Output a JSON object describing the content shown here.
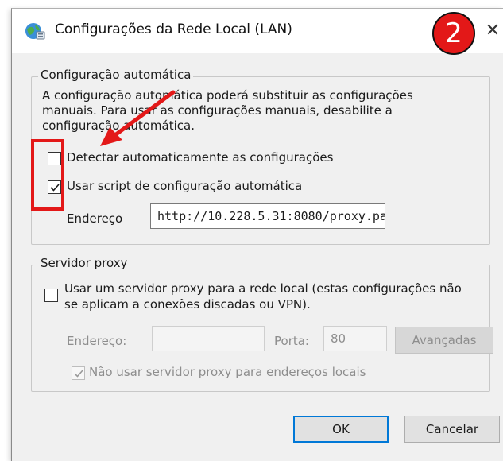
{
  "window": {
    "title": "Configurações da Rede Local (LAN)",
    "close_glyph": "✕",
    "annotation_number": "2"
  },
  "auto_config": {
    "legend": "Configuração automática",
    "description_line1": "A configuração automática poderá substituir as configurações",
    "description_line2": "manuais. Para usar as configurações manuais, desabilite a",
    "description_line3": "configuração automática.",
    "detect_label": "Detectar automaticamente as configurações",
    "detect_checked": false,
    "script_label": "Usar script de configuração automática",
    "script_checked": true,
    "address_label": "Endereço",
    "address_value": "http://10.228.5.31:8080/proxy.pa"
  },
  "proxy": {
    "legend": "Servidor proxy",
    "use_proxy_line1": "Usar um servidor proxy para a rede local (estas configurações não",
    "use_proxy_line2": "se aplicam a conexões discadas ou VPN).",
    "use_proxy_checked": false,
    "address_label": "Endereço:",
    "address_value": "",
    "port_label": "Porta:",
    "port_value": "80",
    "advanced_label": "Avançadas",
    "bypass_label": "Não usar servidor proxy para endereços locais",
    "bypass_checked": true
  },
  "footer": {
    "ok_label": "OK",
    "cancel_label": "Cancelar"
  },
  "colors": {
    "annotation_red": "#e31818",
    "focus_blue": "#0078d7",
    "dialog_bg": "#f0f0f0"
  },
  "icons": {
    "app": "network-globe-icon",
    "close": "close-icon",
    "check": "checkmark-icon"
  }
}
